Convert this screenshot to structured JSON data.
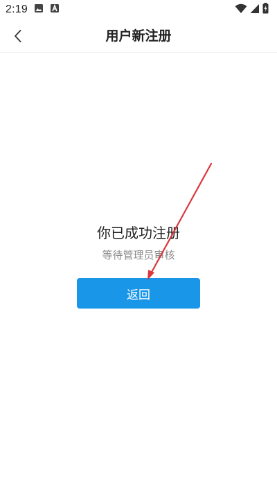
{
  "status_bar": {
    "time": "2:19",
    "icons": [
      "image-icon",
      "a-notification-icon",
      "wifi-icon",
      "signal-icon",
      "battery-charging-icon"
    ]
  },
  "nav": {
    "title": "用户新注册",
    "back_icon": "chevron-left-icon"
  },
  "main": {
    "success_title": "你已成功注册",
    "success_subtitle": "等待管理员审核",
    "return_button_label": "返回"
  },
  "colors": {
    "primary_button": "#1a96e9",
    "annotation_arrow": "#d9373d"
  }
}
